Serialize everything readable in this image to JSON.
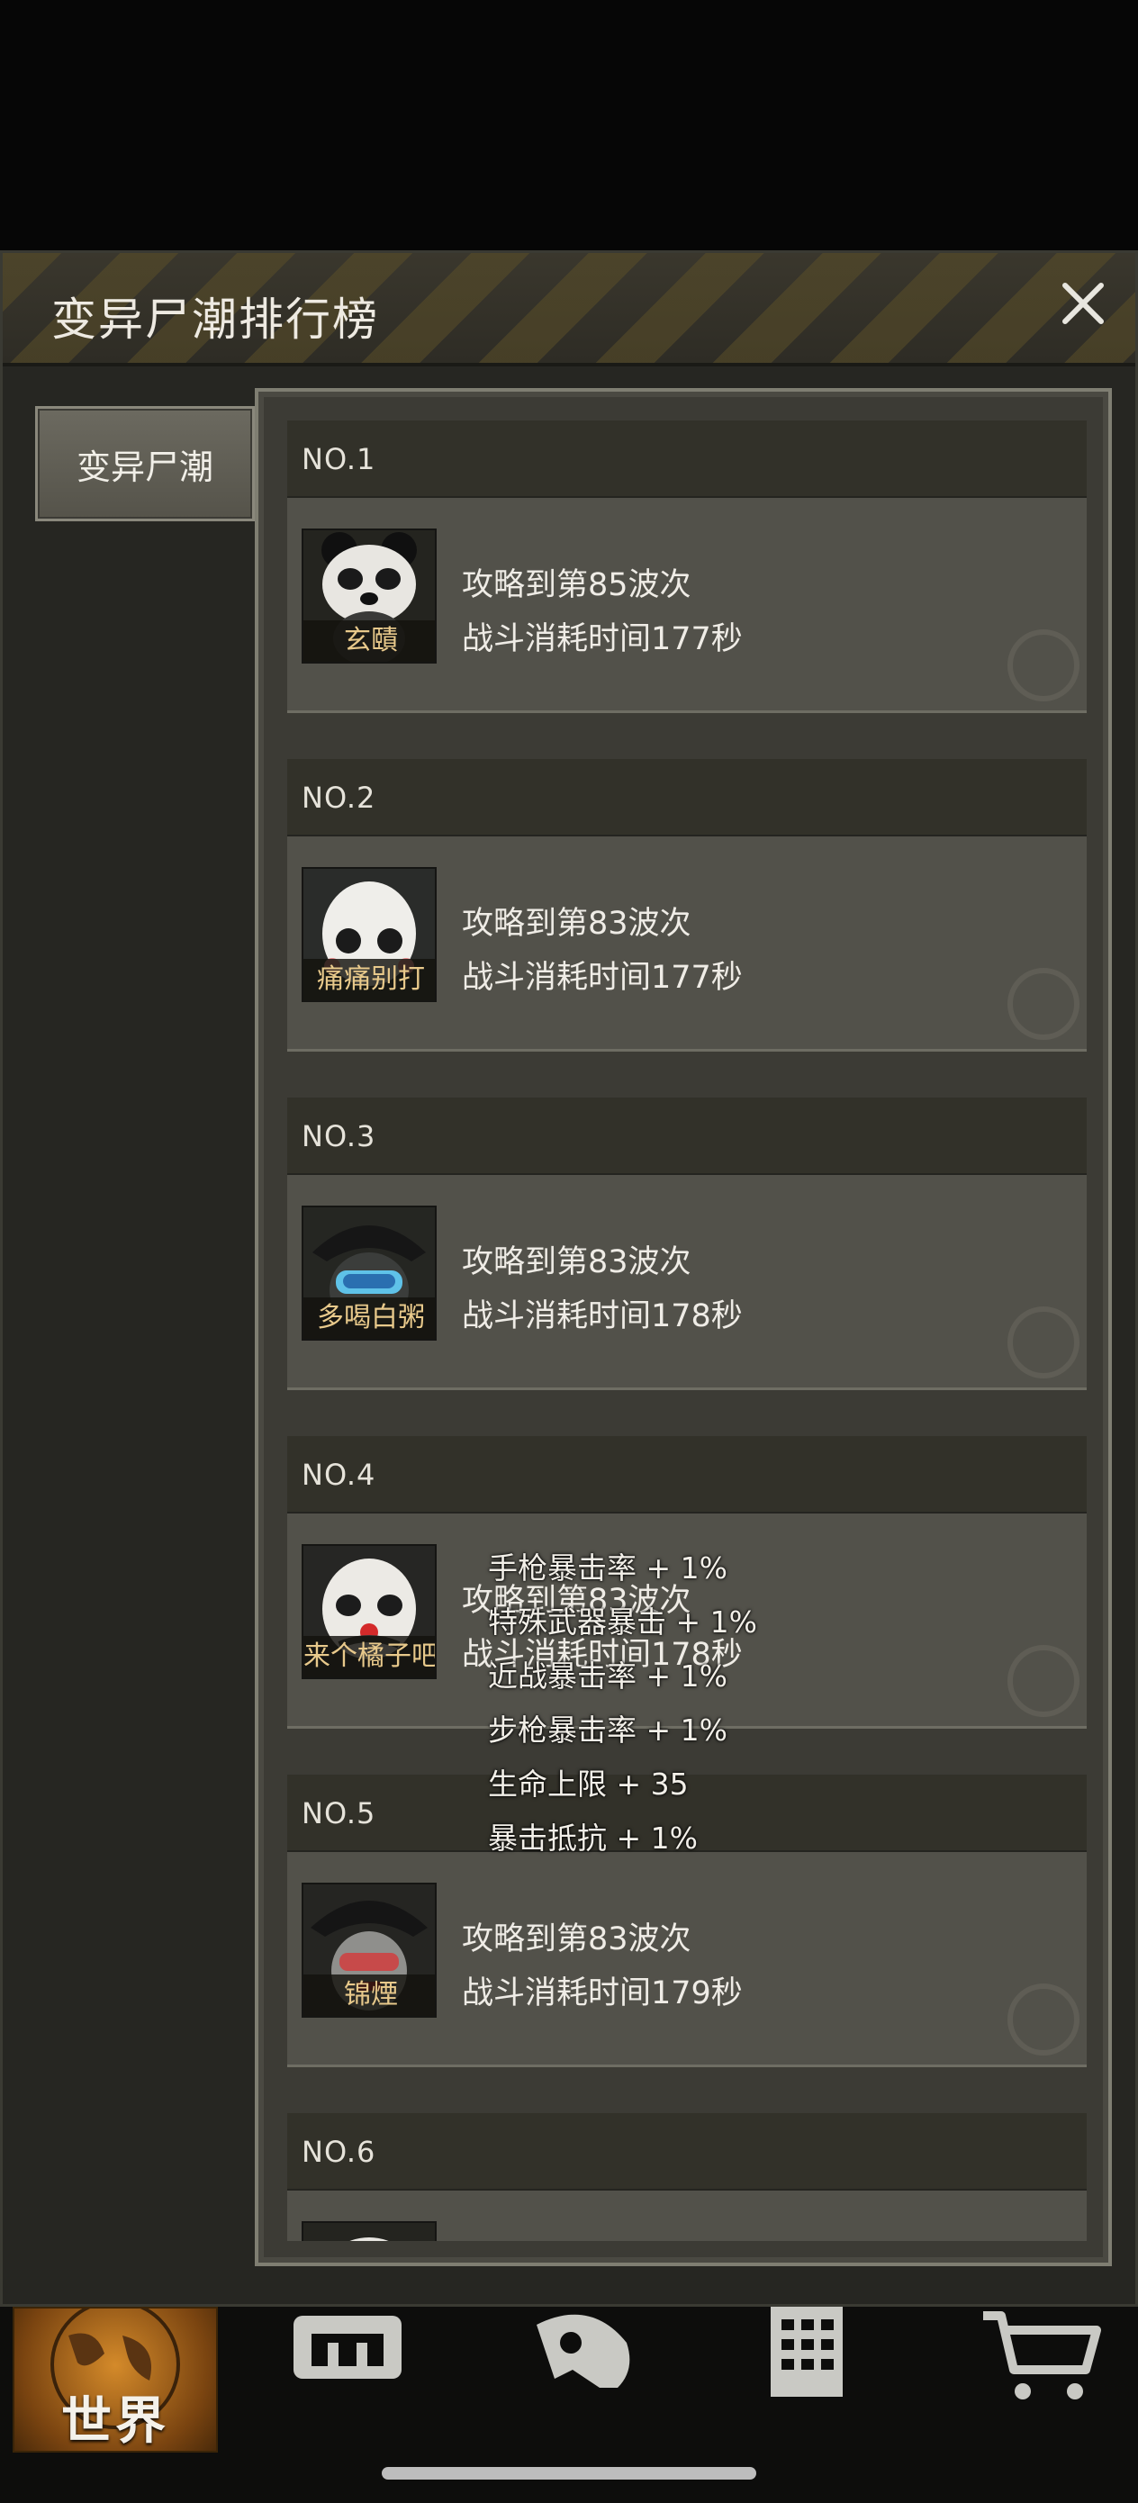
{
  "modal": {
    "title": "变异尸潮排行榜",
    "close_icon": "close-icon"
  },
  "side_tab": {
    "label": "变异尸潮"
  },
  "entries": [
    {
      "rank": "NO.1",
      "name": "玄賾",
      "line1": "攻略到第85波次",
      "line2": "战斗消耗时间177秒"
    },
    {
      "rank": "NO.2",
      "name": "痛痛别打",
      "line1": "攻略到第83波次",
      "line2": "战斗消耗时间177秒"
    },
    {
      "rank": "NO.3",
      "name": "多喝白粥",
      "line1": "攻略到第83波次",
      "line2": "战斗消耗时间178秒"
    },
    {
      "rank": "NO.4",
      "name": "来个橘子吧",
      "line1": "攻略到第83波次",
      "line2": "战斗消耗时间178秒"
    },
    {
      "rank": "NO.5",
      "name": "锦煙",
      "line1": "攻略到第83波次",
      "line2": "战斗消耗时间179秒"
    },
    {
      "rank": "NO.6",
      "name": "",
      "line1": "",
      "line2": ""
    }
  ],
  "tooltip": [
    "手枪暴击率 + 1%",
    "特殊武器暴击 + 1%",
    "近战暴击率 + 1%",
    "步枪暴击率 + 1%",
    "生命上限 + 35",
    "暴击抵抗 + 1%"
  ],
  "bottom_nav": {
    "world_label": "世界",
    "icons": [
      "globe-icon",
      "backpack-icon",
      "head-icon",
      "building-icon",
      "cart-icon"
    ]
  },
  "colors": {
    "name_gold": "#e8c98b",
    "world_orange": "#d48a2a"
  }
}
